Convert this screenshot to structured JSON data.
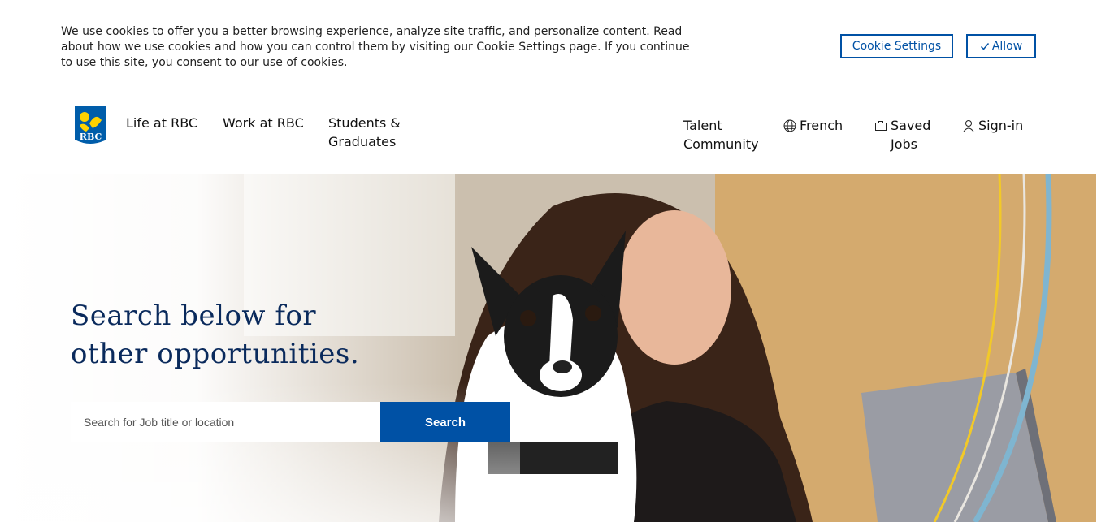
{
  "cookie_banner": {
    "text": "We use cookies to offer you a better browsing experience, analyze site traffic, and personalize content. Read about how we use cookies and how you can control them by visiting our Cookie Settings page. If you continue to use this site, you consent to our use of cookies.",
    "settings_label": "Cookie Settings",
    "allow_label": "Allow",
    "accent_color": "#0051a5"
  },
  "header": {
    "logo_text": "RBC",
    "nav_left": {
      "life": "Life at RBC",
      "work": "Work at RBC",
      "students": "Students & Graduates"
    },
    "nav_right": {
      "talent": "Talent Community",
      "french": "French",
      "saved": "Saved Jobs",
      "signin": "Sign-in"
    },
    "icons": {
      "french": "globe-icon",
      "saved": "briefcase-icon",
      "signin": "user-icon"
    }
  },
  "hero": {
    "title_line1": "Search below for",
    "title_line2": "other opportunities.",
    "search_placeholder": "Search for Job title or location",
    "search_button": "Search",
    "title_color": "#0a2a5c"
  }
}
